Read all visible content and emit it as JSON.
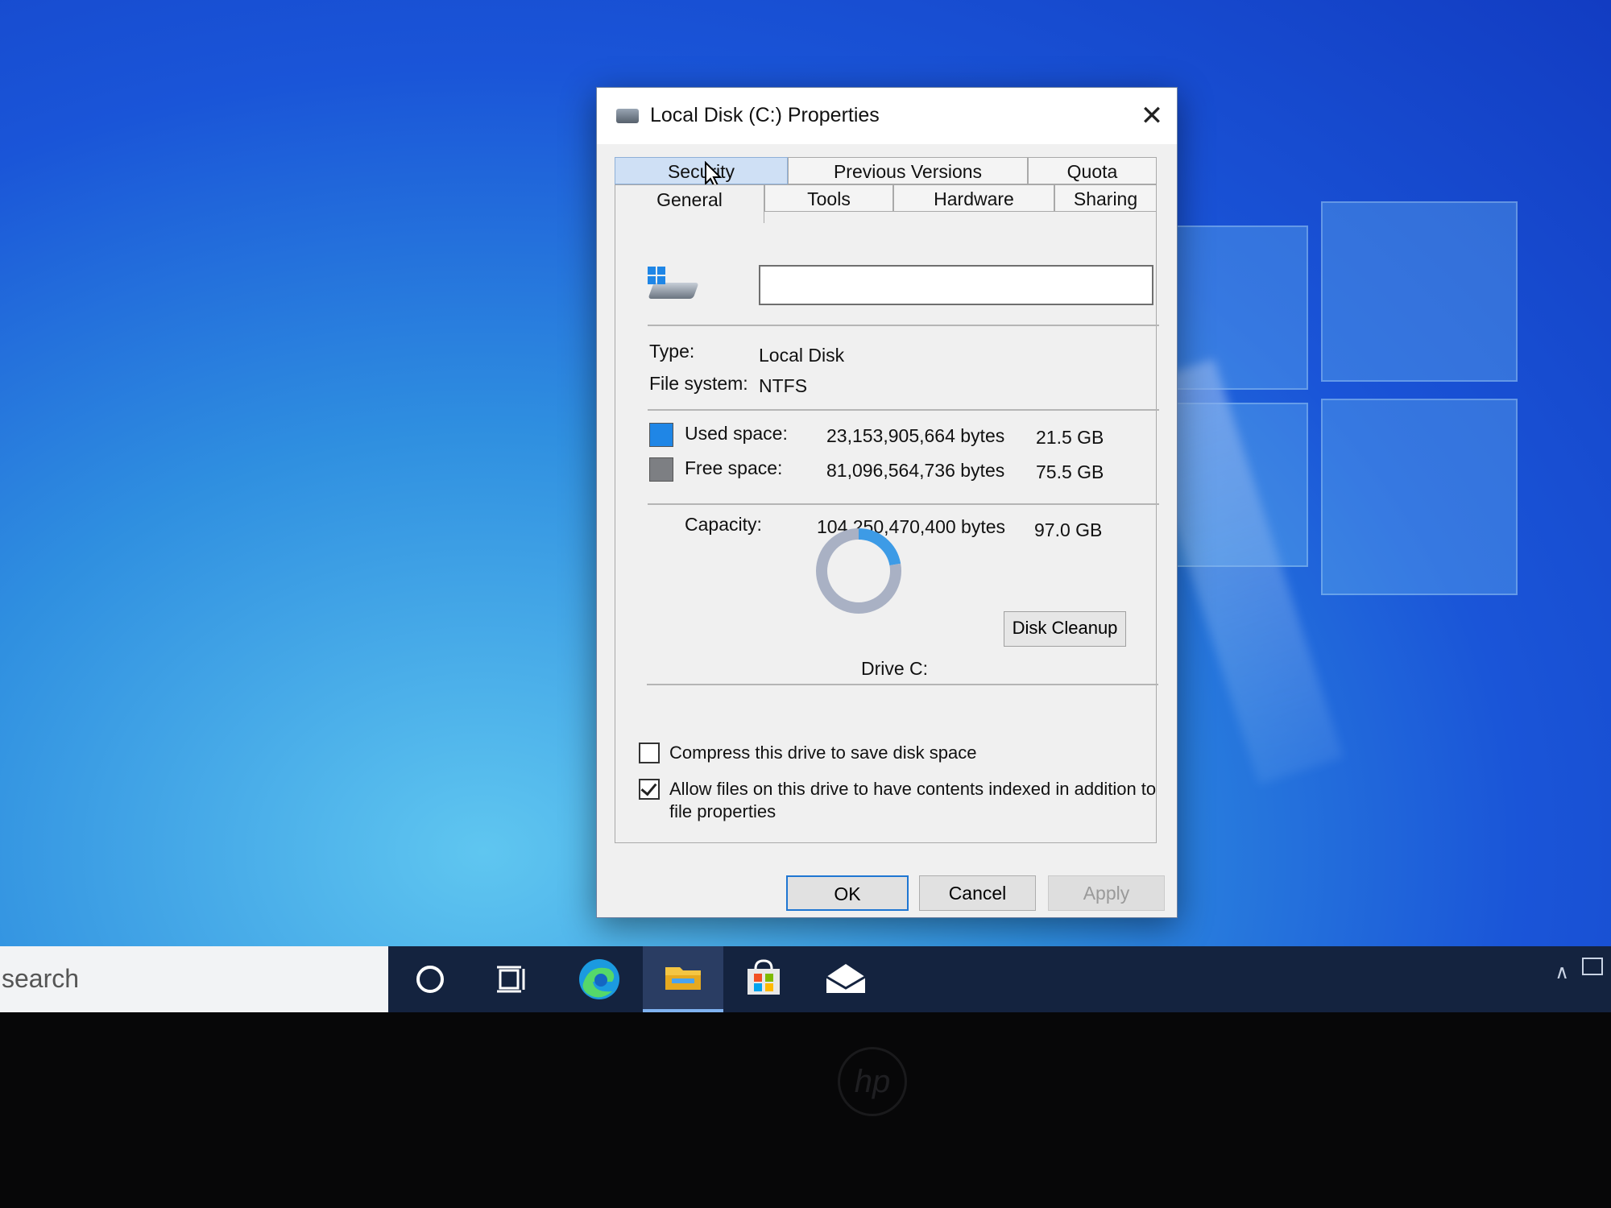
{
  "window": {
    "title": "Local Disk (C:) Properties",
    "close_label": "✕"
  },
  "tabs": {
    "row_back": [
      "Security",
      "Previous Versions",
      "Quota"
    ],
    "row_front": [
      "General",
      "Tools",
      "Hardware",
      "Sharing"
    ],
    "active": "General"
  },
  "general": {
    "volume_label_value": "",
    "type_label": "Type:",
    "type_value": "Local Disk",
    "fs_label": "File system:",
    "fs_value": "NTFS",
    "used_label": "Used space:",
    "used_bytes": "23,153,905,664 bytes",
    "used_gb": "21.5 GB",
    "free_label": "Free space:",
    "free_bytes": "81,096,564,736 bytes",
    "free_gb": "75.5 GB",
    "capacity_label": "Capacity:",
    "capacity_bytes": "104,250,470,400 bytes",
    "capacity_gb": "97.0 GB",
    "drive_label": "Drive C:",
    "cleanup_label": "Disk Cleanup",
    "compress_label": "Compress this drive to save disk space",
    "compress_checked": false,
    "index_label_1": "Allow files on this drive to have contents indexed in addition to",
    "index_label_2": "file properties",
    "index_checked": true
  },
  "colors": {
    "used": "#1f86e6",
    "free": "#7d7f83",
    "donut_used": "#3d9be6",
    "donut_free": "#a9b1c4"
  },
  "buttons": {
    "ok": "OK",
    "cancel": "Cancel",
    "apply": "Apply"
  },
  "taskbar": {
    "search_text": "search",
    "icons": [
      "cortana-circle-icon",
      "task-view-icon",
      "edge-icon",
      "file-explorer-icon",
      "store-icon",
      "mail-icon"
    ]
  },
  "chart_data": {
    "type": "pie",
    "categories": [
      "Used space",
      "Free space"
    ],
    "values": [
      21.5,
      75.5
    ]
  }
}
